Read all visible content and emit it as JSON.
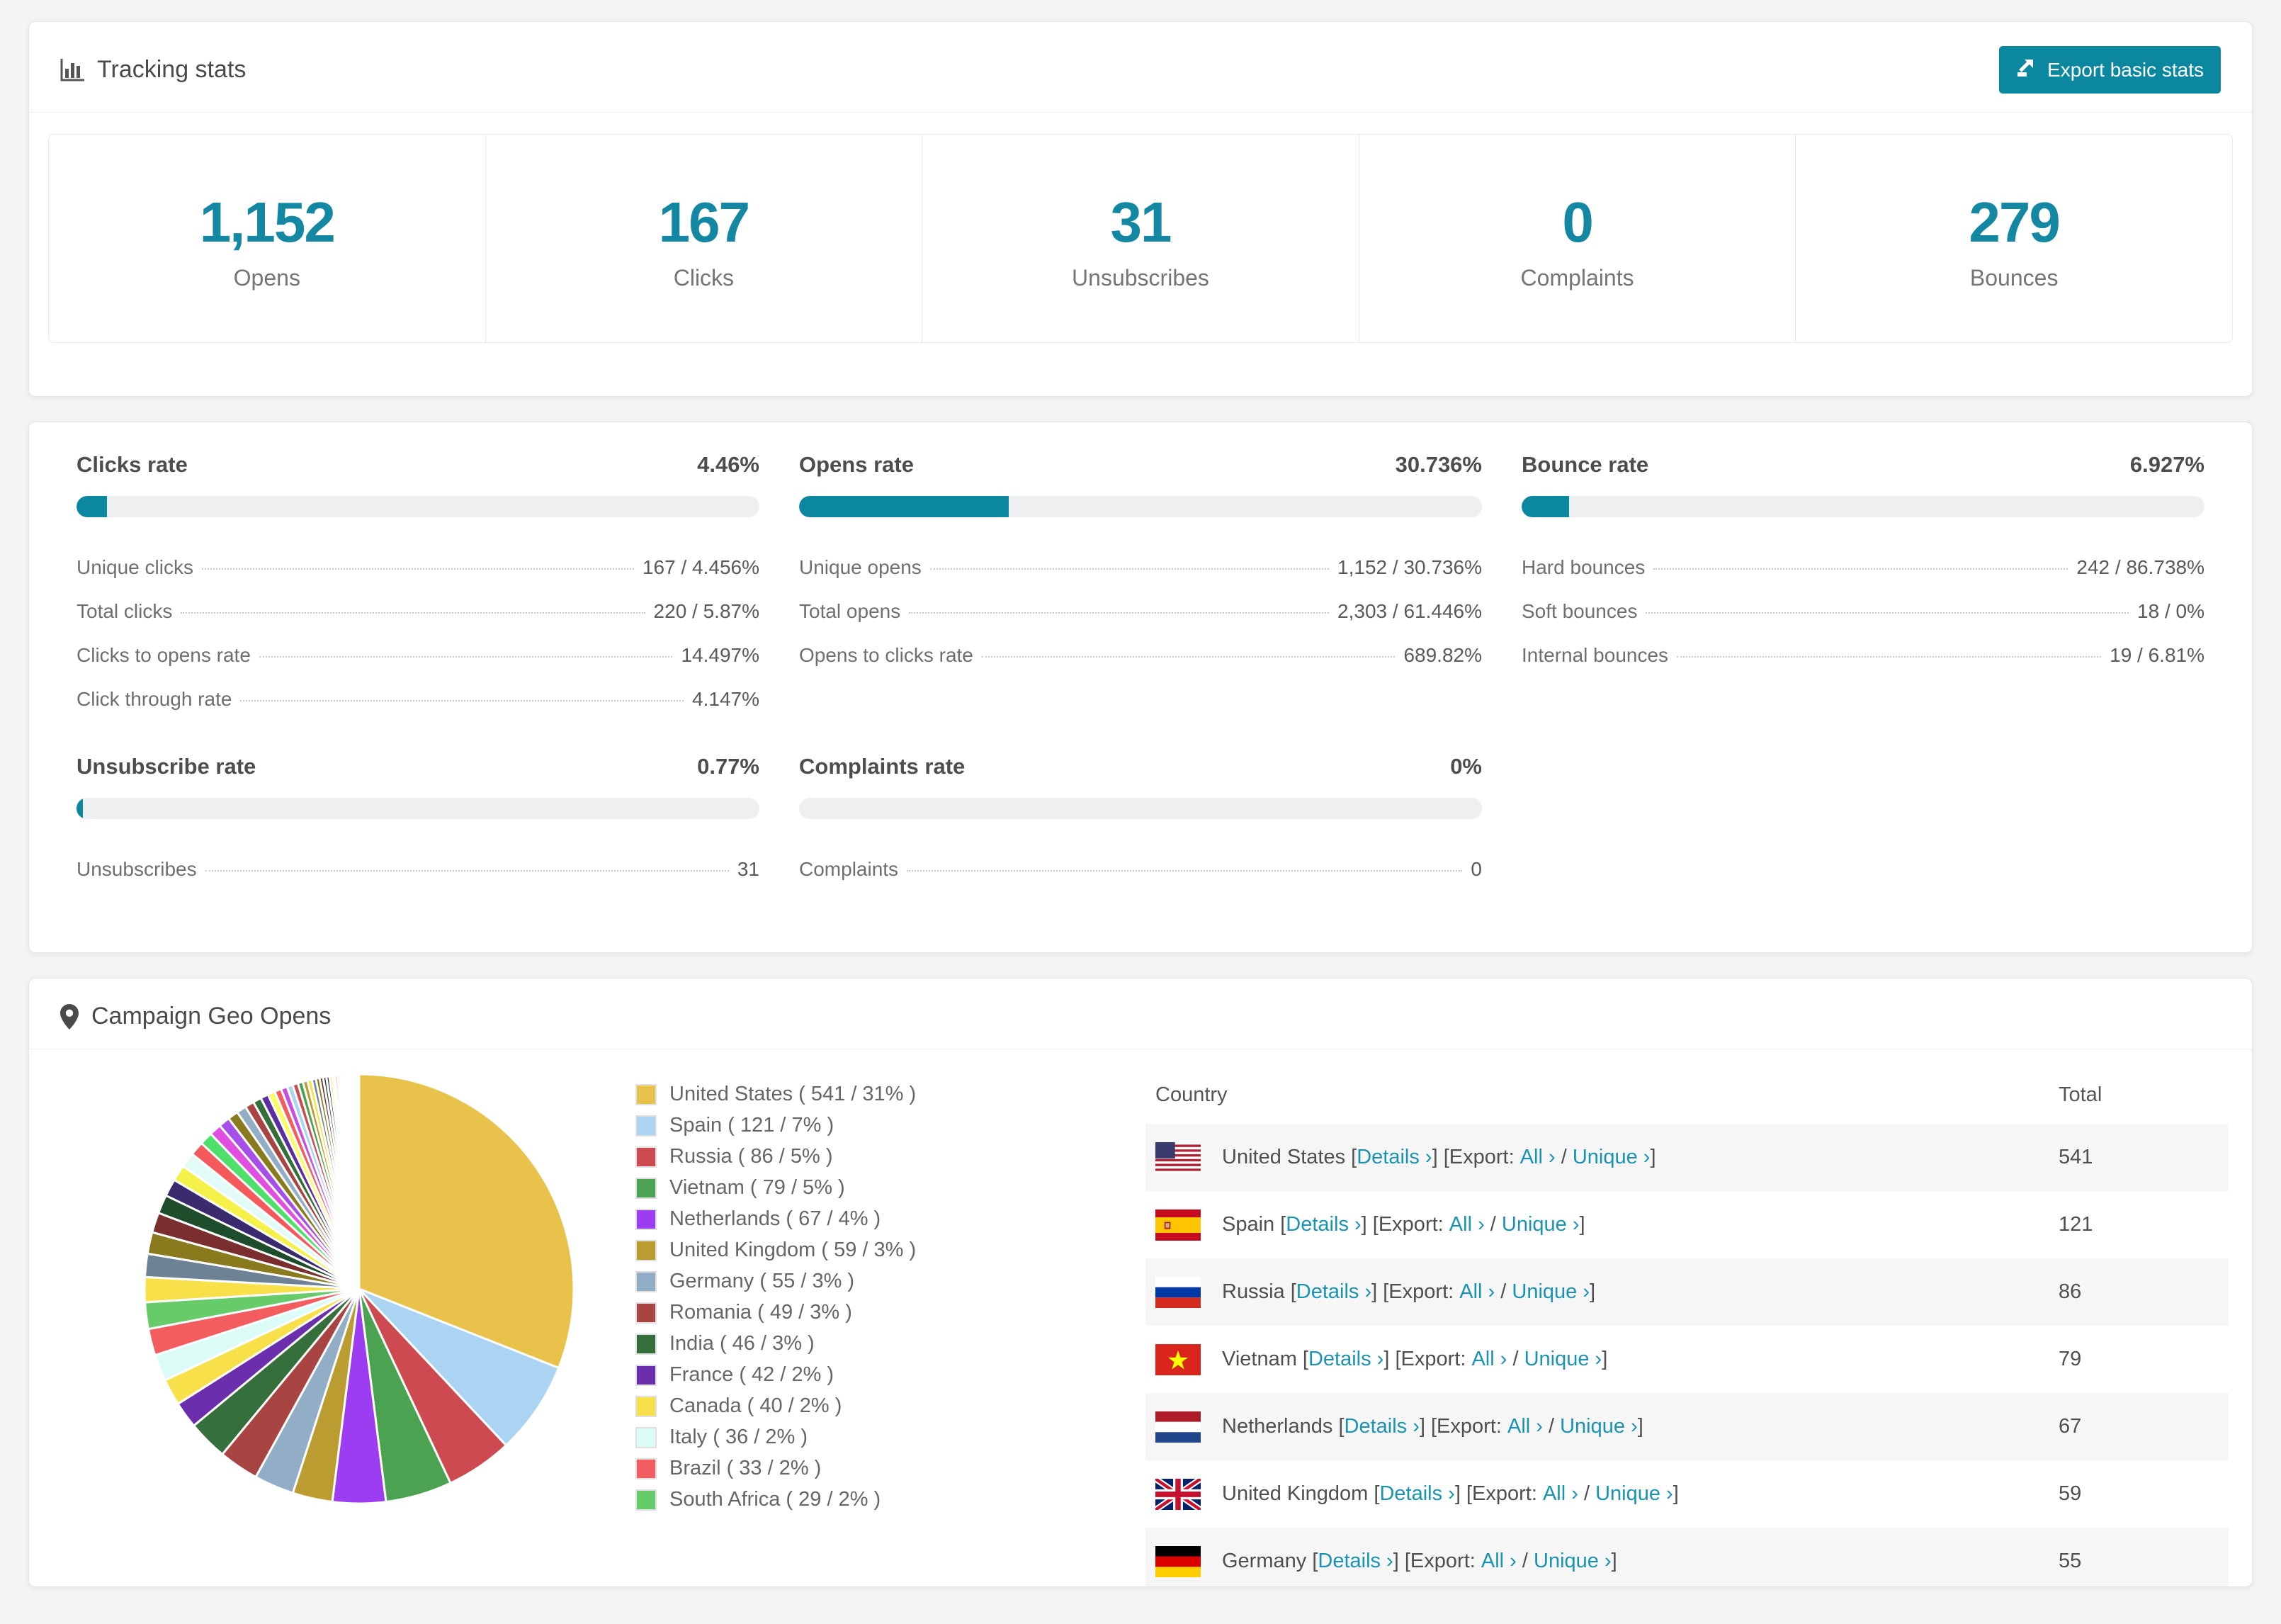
{
  "accent_color": "#0b87a0",
  "link_color": "#1a93b2",
  "header": {
    "title": "Tracking stats",
    "export_label": "Export basic stats"
  },
  "stats": [
    {
      "value": "1,152",
      "label": "Opens"
    },
    {
      "value": "167",
      "label": "Clicks"
    },
    {
      "value": "31",
      "label": "Unsubscribes"
    },
    {
      "value": "0",
      "label": "Complaints"
    },
    {
      "value": "279",
      "label": "Bounces"
    }
  ],
  "rate_panels": [
    {
      "id": "clicks",
      "title": "Clicks rate",
      "value": "4.46%",
      "pct": 4.46,
      "rows": [
        {
          "label": "Unique clicks",
          "value": "167 / 4.456%"
        },
        {
          "label": "Total clicks",
          "value": "220 / 5.87%"
        },
        {
          "label": "Clicks to opens rate",
          "value": "14.497%"
        },
        {
          "label": "Click through rate",
          "value": "4.147%"
        }
      ]
    },
    {
      "id": "opens",
      "title": "Opens rate",
      "value": "30.736%",
      "pct": 30.736,
      "rows": [
        {
          "label": "Unique opens",
          "value": "1,152 / 30.736%"
        },
        {
          "label": "Total opens",
          "value": "2,303 / 61.446%"
        },
        {
          "label": "Opens to clicks rate",
          "value": "689.82%"
        }
      ]
    },
    {
      "id": "bounce",
      "title": "Bounce rate",
      "value": "6.927%",
      "pct": 6.927,
      "rows": [
        {
          "label": "Hard bounces",
          "value": "242 / 86.738%"
        },
        {
          "label": "Soft bounces",
          "value": "18 / 0%"
        },
        {
          "label": "Internal bounces",
          "value": "19 / 6.81%"
        }
      ]
    },
    {
      "id": "unsubscribe",
      "title": "Unsubscribe rate",
      "value": "0.77%",
      "pct": 0.77,
      "rows": [
        {
          "label": "Unsubscribes",
          "value": "31"
        }
      ]
    },
    {
      "id": "complaints",
      "title": "Complaints rate",
      "value": "0%",
      "pct": 0,
      "rows": [
        {
          "label": "Complaints",
          "value": "0"
        }
      ]
    }
  ],
  "geo": {
    "title": "Campaign Geo Opens",
    "legend": [
      {
        "label": "United States ( 541 / 31% )",
        "color": "#e8c24a"
      },
      {
        "label": "Spain ( 121 / 7% )",
        "color": "#abd3f2"
      },
      {
        "label": "Russia ( 86 / 5% )",
        "color": "#cd4b50"
      },
      {
        "label": "Vietnam ( 79 / 5% )",
        "color": "#4ba352"
      },
      {
        "label": "Netherlands ( 67 / 4% )",
        "color": "#9c3df2"
      },
      {
        "label": "United Kingdom ( 59 / 3% )",
        "color": "#bb9c31"
      },
      {
        "label": "Germany ( 55 / 3% )",
        "color": "#92aec7"
      },
      {
        "label": "Romania ( 49 / 3% )",
        "color": "#a84442"
      },
      {
        "label": "India ( 46 / 3% )",
        "color": "#356f3c"
      },
      {
        "label": "France ( 42 / 2% )",
        "color": "#6b2fae"
      },
      {
        "label": "Canada ( 40 / 2% )",
        "color": "#f8e04b"
      },
      {
        "label": "Italy ( 36 / 2% )",
        "color": "#dcfcf8"
      },
      {
        "label": "Brazil ( 33 / 2% )",
        "color": "#f45d60"
      },
      {
        "label": "South Africa ( 29 / 2% )",
        "color": "#66cb68"
      }
    ],
    "table": {
      "columns": {
        "country": "Country",
        "total": "Total"
      },
      "labels": {
        "bracket_open": "[",
        "bracket_close": "]",
        "details": "Details ›",
        "export_prefix": "[Export:",
        "all": "All ›",
        "slash": "/",
        "unique": "Unique ›"
      },
      "rows": [
        {
          "country": "United States",
          "flag": "us",
          "total": "541"
        },
        {
          "country": "Spain",
          "flag": "es",
          "total": "121"
        },
        {
          "country": "Russia",
          "flag": "ru",
          "total": "86"
        },
        {
          "country": "Vietnam",
          "flag": "vn",
          "total": "79"
        },
        {
          "country": "Netherlands",
          "flag": "nl",
          "total": "67"
        },
        {
          "country": "United Kingdom",
          "flag": "gb",
          "total": "59"
        },
        {
          "country": "Germany",
          "flag": "de",
          "total": "55"
        }
      ]
    }
  },
  "chart_data": {
    "type": "pie",
    "title": "Campaign Geo Opens",
    "legend_position": "right",
    "slices": [
      {
        "name": "United States",
        "value": 541,
        "pct": 31,
        "color": "#e8c24a"
      },
      {
        "name": "Spain",
        "value": 121,
        "pct": 7,
        "color": "#abd3f2"
      },
      {
        "name": "Russia",
        "value": 86,
        "pct": 5,
        "color": "#cd4b50"
      },
      {
        "name": "Vietnam",
        "value": 79,
        "pct": 5,
        "color": "#4ba352"
      },
      {
        "name": "Netherlands",
        "value": 67,
        "pct": 4,
        "color": "#9c3df2"
      },
      {
        "name": "United Kingdom",
        "value": 59,
        "pct": 3,
        "color": "#bb9c31"
      },
      {
        "name": "Germany",
        "value": 55,
        "pct": 3,
        "color": "#92aec7"
      },
      {
        "name": "Romania",
        "value": 49,
        "pct": 3,
        "color": "#a84442"
      },
      {
        "name": "India",
        "value": 46,
        "pct": 3,
        "color": "#356f3c"
      },
      {
        "name": "France",
        "value": 42,
        "pct": 2,
        "color": "#6b2fae"
      },
      {
        "name": "Canada",
        "value": 40,
        "pct": 2,
        "color": "#f8e04b"
      },
      {
        "name": "Italy",
        "value": 36,
        "pct": 2,
        "color": "#dcfcf8"
      },
      {
        "name": "Brazil",
        "value": 33,
        "pct": 2,
        "color": "#f45d60"
      },
      {
        "name": "South Africa",
        "value": 29,
        "pct": 2,
        "color": "#66cb68"
      }
    ],
    "tail": {
      "pct": 26,
      "count": 48,
      "decay": 0.93,
      "colors": [
        "#f8e04b",
        "#6e8296",
        "#8a7a1e",
        "#7a2e2e",
        "#1e4d2b",
        "#3a2a6e",
        "#f5f04a",
        "#e3fbf7",
        "#f4595c",
        "#4ee06a",
        "#e14fe1",
        "#a64fe8",
        "#8a7a1e",
        "#92aec7",
        "#a84442",
        "#356f3c",
        "#5b2da0",
        "#fafa66",
        "#f45d60",
        "#c44fe0",
        "#abd3f2",
        "#cd4b50",
        "#4ba352",
        "#bb9c31"
      ]
    }
  }
}
